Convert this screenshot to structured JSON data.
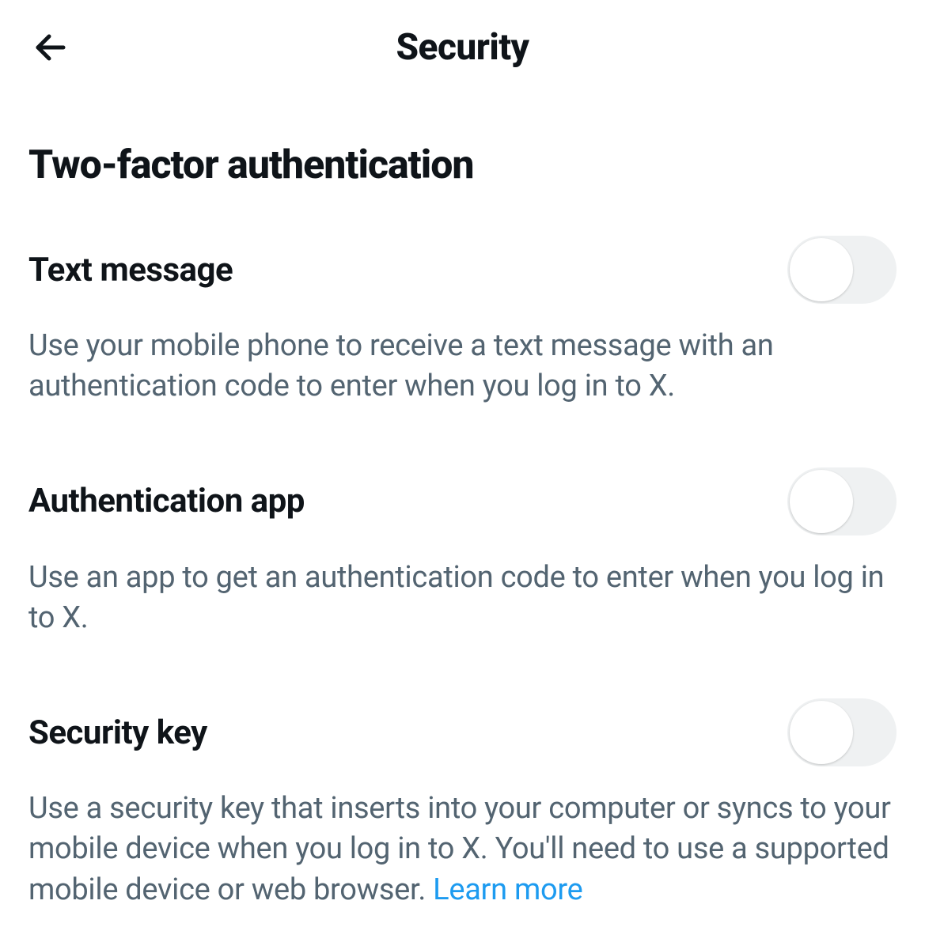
{
  "header": {
    "title": "Security"
  },
  "section": {
    "title": "Two-factor authentication"
  },
  "settings": [
    {
      "id": "text-message",
      "label": "Text message",
      "description": "Use your mobile phone to receive a text message with an authentication code to enter when you log in to X.",
      "enabled": false,
      "learn_more": null
    },
    {
      "id": "authentication-app",
      "label": "Authentication app",
      "description": "Use an app to get an authentication code to enter when you log in to X.",
      "enabled": false,
      "learn_more": null
    },
    {
      "id": "security-key",
      "label": "Security key",
      "description": "Use a security key that inserts into your computer or syncs to your mobile device when you log in to X. You'll need to use a supported mobile device or web browser. ",
      "enabled": false,
      "learn_more": "Learn more"
    }
  ]
}
